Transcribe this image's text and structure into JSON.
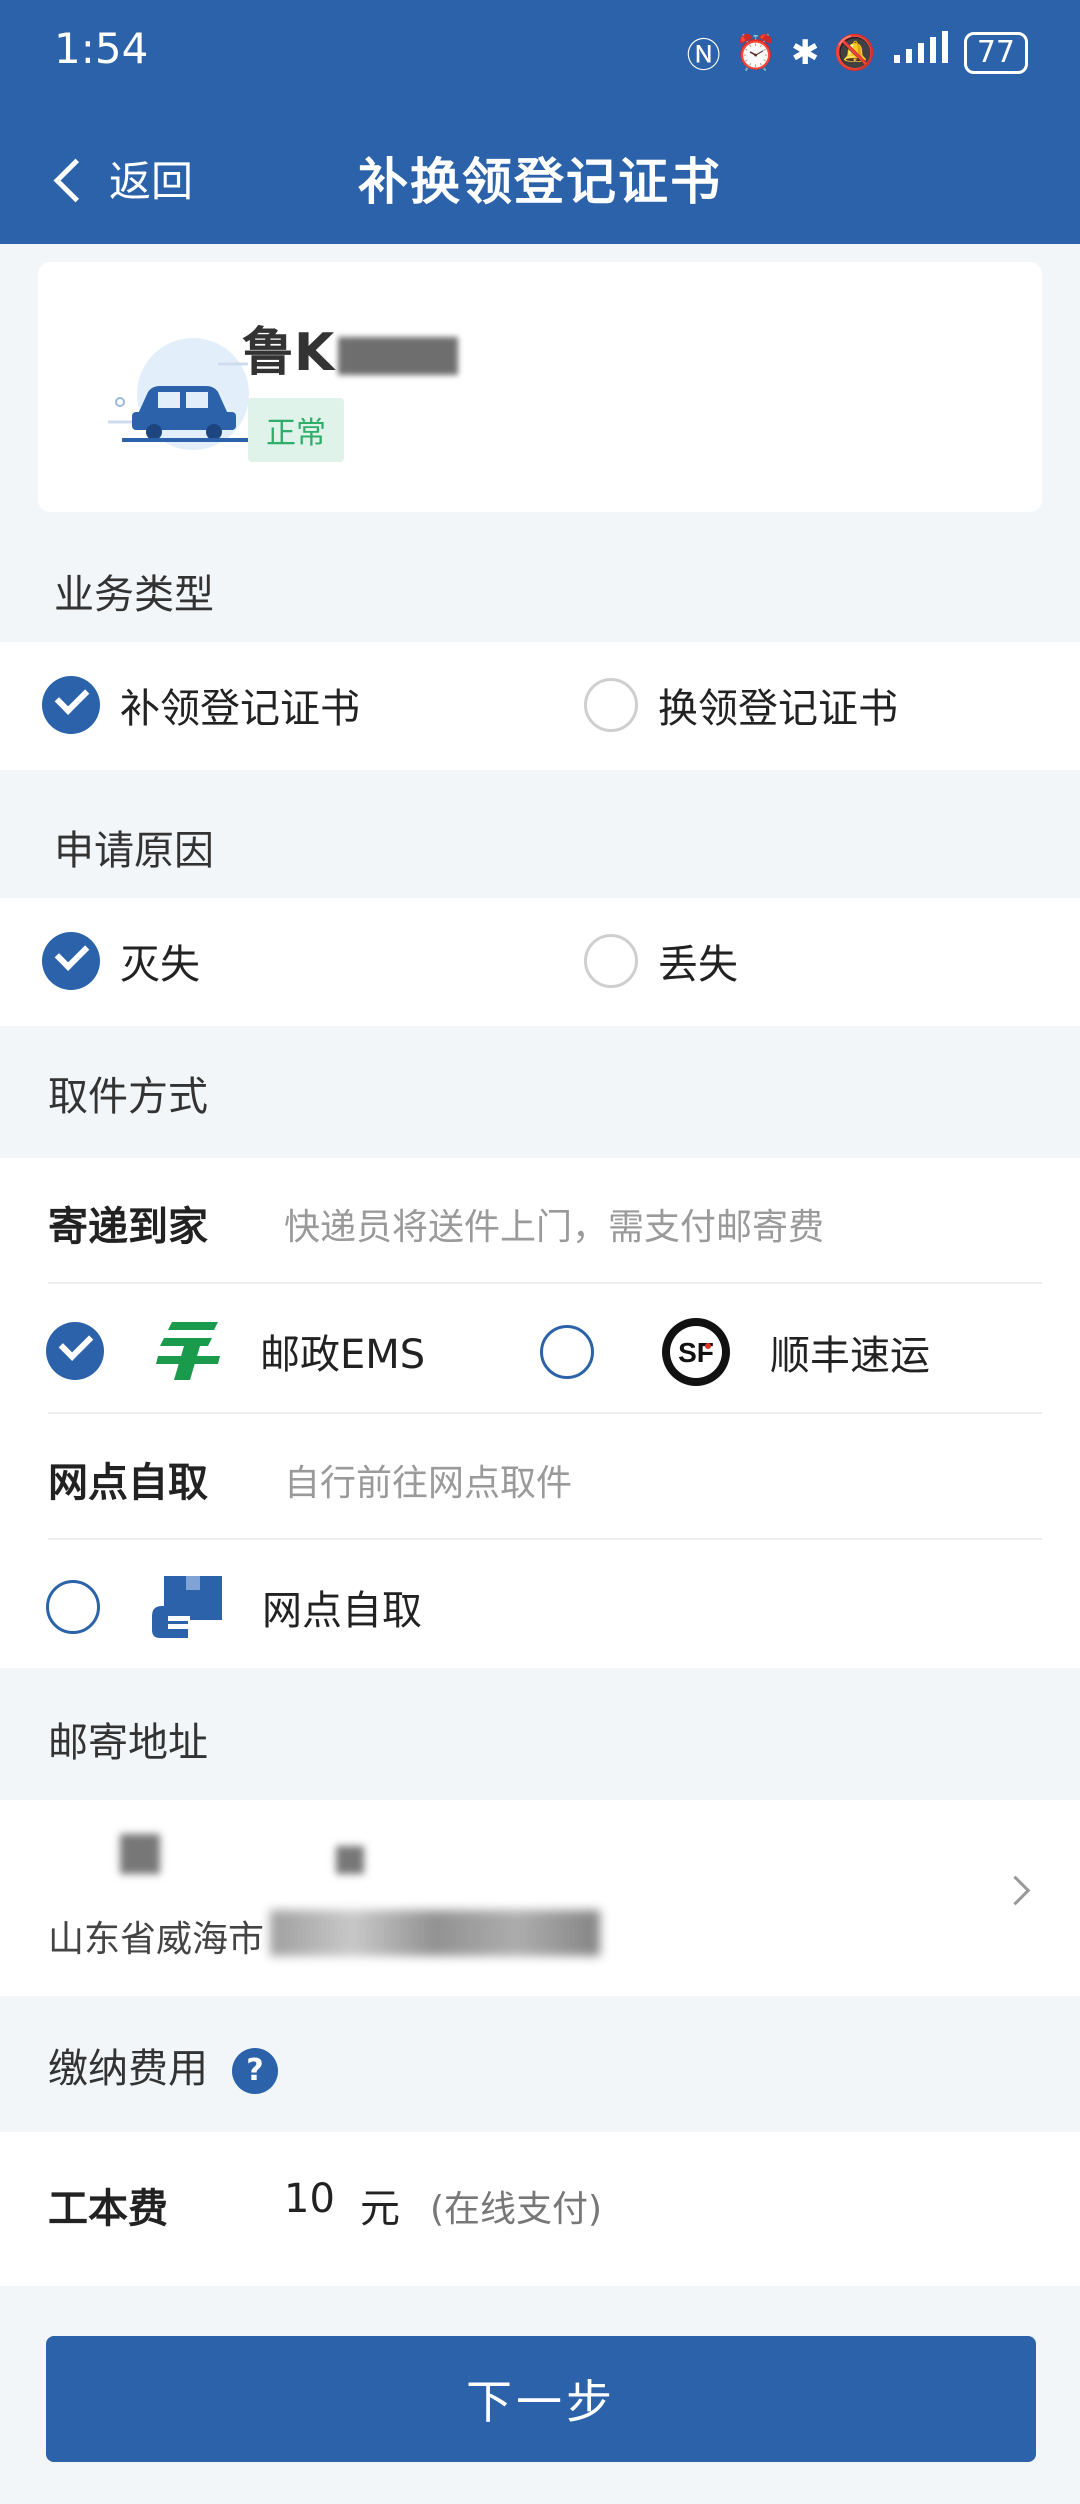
{
  "status_bar": {
    "time": "1:54",
    "battery": "77"
  },
  "header": {
    "back_label": "返回",
    "title": "补换领登记证书"
  },
  "vehicle": {
    "plate": "鲁K",
    "status": "正常"
  },
  "business_type": {
    "title": "业务类型",
    "options": [
      {
        "label": "补领登记证书",
        "selected": true
      },
      {
        "label": "换领登记证书",
        "selected": false
      }
    ]
  },
  "reason": {
    "title": "申请原因",
    "options": [
      {
        "label": "灭失",
        "selected": true
      },
      {
        "label": "丢失",
        "selected": false
      }
    ]
  },
  "pickup": {
    "title": "取件方式",
    "delivery": {
      "label": "寄递到家",
      "hint": "快递员将送件上门，需支付邮寄费",
      "options": [
        {
          "label": "邮政EMS",
          "icon": "ems-logo-icon",
          "selected": true
        },
        {
          "label": "顺丰速运",
          "icon": "sf-logo-icon",
          "selected": false
        }
      ]
    },
    "self": {
      "label": "网点自取",
      "hint": "自行前往网点取件",
      "option": {
        "label": "网点自取",
        "icon": "package-hand-icon",
        "selected": false
      }
    }
  },
  "address": {
    "title": "邮寄地址",
    "line2": "山东省威海市"
  },
  "fees": {
    "title": "缴纳费用",
    "help": "?",
    "label": "工本费",
    "amount": "10",
    "unit": "元",
    "note": "(在线支付)"
  },
  "next_button": "下一步",
  "colors": {
    "primary": "#2b62a9",
    "ok_tag_bg": "#dff3ea",
    "ok_tag_text": "#2fae6a",
    "ems_green": "#1a9a4b"
  }
}
